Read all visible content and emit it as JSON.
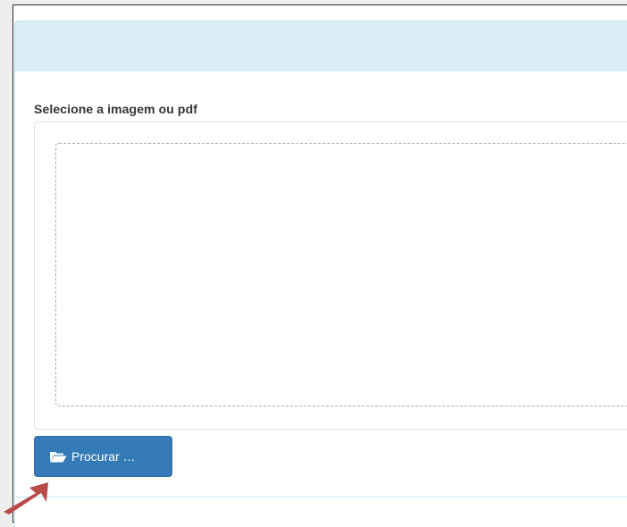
{
  "form": {
    "label": "Selecione a imagem ou pdf",
    "browse_button": {
      "label": "Procurar …",
      "icon": "folder-open-icon"
    }
  },
  "colors": {
    "panel_heading_bg": "#d9edf7",
    "panel_border": "#bce8f1",
    "button_bg": "#337ab7",
    "arrow": "#b84a4a"
  }
}
